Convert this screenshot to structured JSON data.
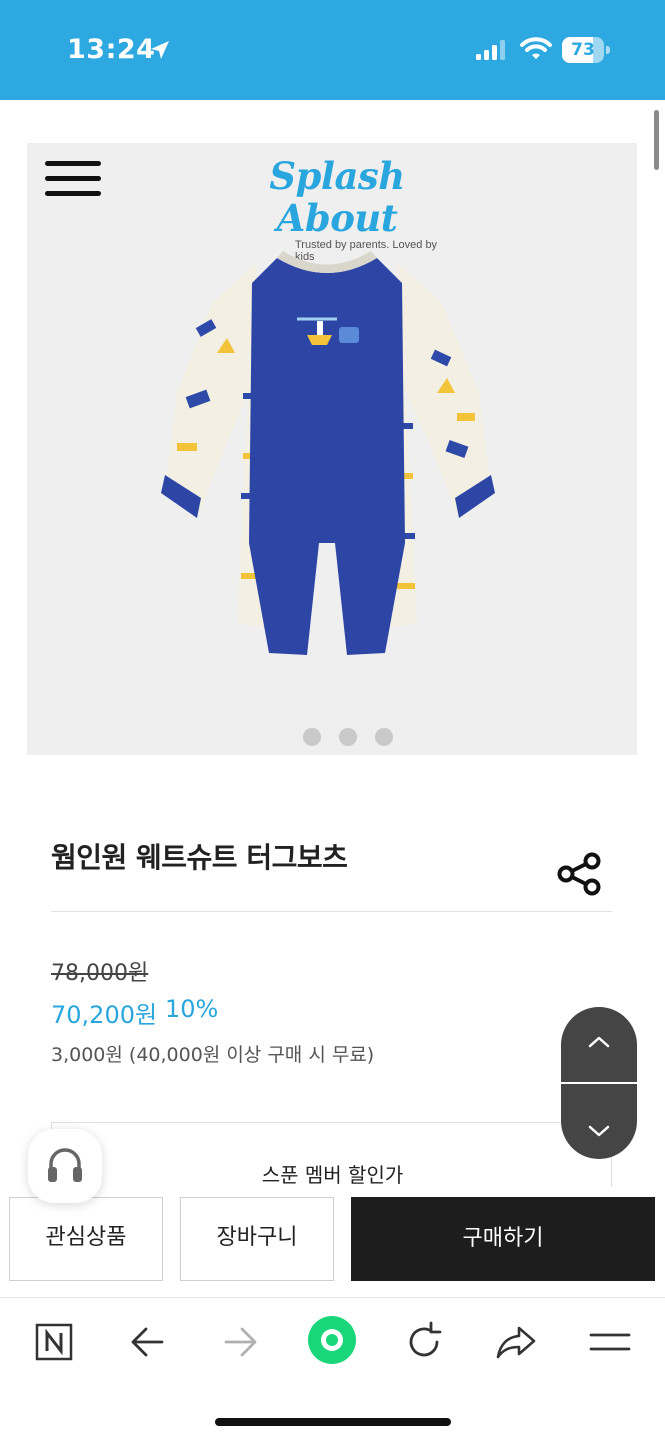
{
  "status_bar": {
    "time": "13:24",
    "battery": "73",
    "battery_level": 0.73,
    "background": "#2ea8e0"
  },
  "hero": {
    "brand_name": "Splash About",
    "brand_tagline": "Trusted by parents. Loved by kids",
    "image": "wetsuit-product-image",
    "slide_count": 3
  },
  "product": {
    "title": "웜인원 웨트슈트 터그보츠",
    "original_price": "78,000원",
    "sale_price": "70,200원",
    "discount": "10%",
    "shipping": "3,000원 (40,000원 이상 구매 시 무료)",
    "member_discount_label": "스푼 멤버 할인가"
  },
  "actions": {
    "wishlist": "관심상품",
    "cart": "장바구니",
    "buy": "구매하기"
  },
  "icons": {
    "menu": "hamburger-icon",
    "share": "share-icon",
    "chat": "headset-icon",
    "scroll_up": "chevron-up-icon",
    "scroll_down": "chevron-down-icon"
  },
  "browser": {
    "items": [
      "naver-home-icon",
      "back-icon",
      "forward-icon",
      "green-dot-icon",
      "reload-icon",
      "share-arrow-icon",
      "menu-icon"
    ]
  },
  "colors": {
    "accent": "#2aa6de",
    "buy_button": "#1d1d1d",
    "green": "#19d67a"
  }
}
